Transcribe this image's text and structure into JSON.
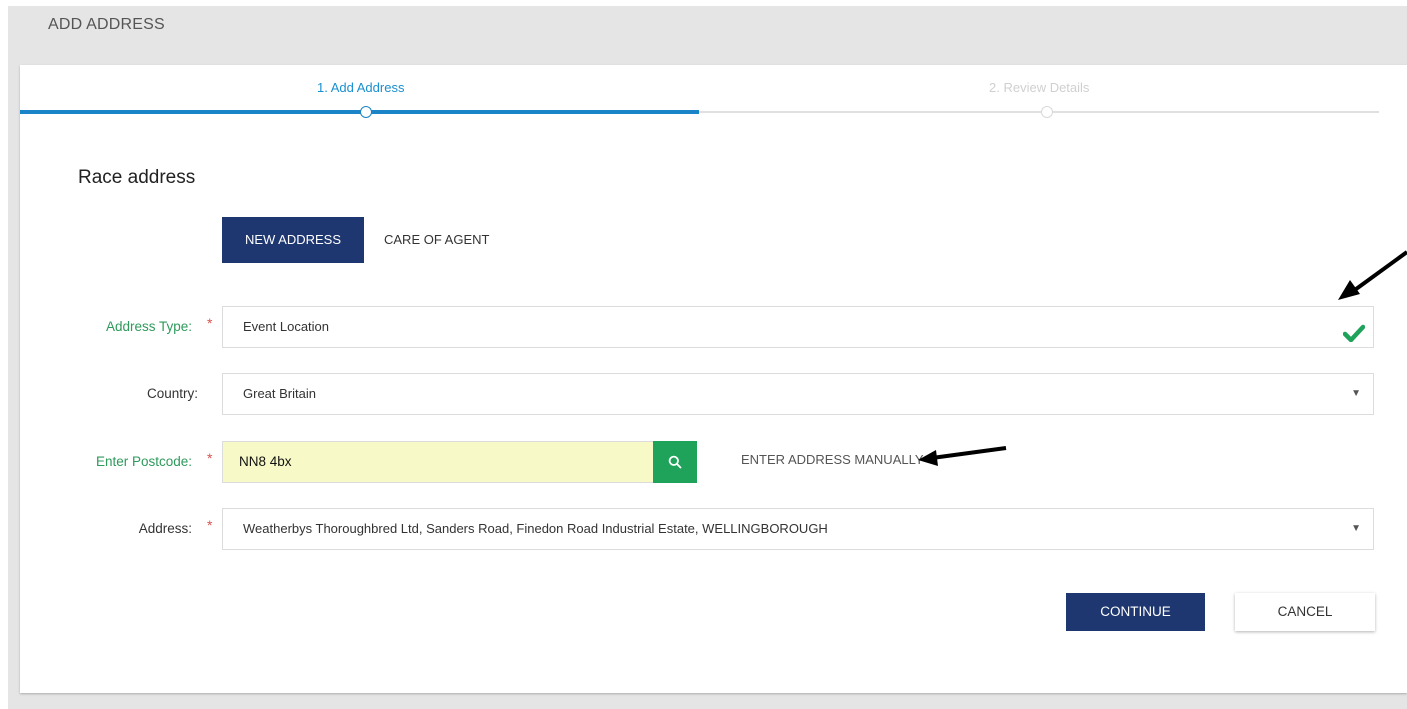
{
  "page": {
    "title": "ADD ADDRESS"
  },
  "stepper": {
    "steps": [
      {
        "label": "1. Add Address",
        "state": "active"
      },
      {
        "label": "2. Review Details",
        "state": "inactive"
      }
    ],
    "accent": "#1b84c7"
  },
  "section": {
    "title": "Race address"
  },
  "tabs": {
    "new_address": "NEW ADDRESS",
    "care_of_agent": "CARE OF AGENT"
  },
  "form": {
    "address_type": {
      "label": "Address Type:",
      "value": "Event Location",
      "required": true,
      "icon": "checkmark-icon"
    },
    "country": {
      "label": "Country:",
      "value": "Great Britain",
      "required": false
    },
    "postcode": {
      "label": "Enter Postcode:",
      "value": "NN8 4bx",
      "required": true
    },
    "enter_manually": "ENTER ADDRESS MANUALLY",
    "address": {
      "label": "Address:",
      "value": "Weatherbys Thoroughbred Ltd, Sanders Road, Finedon Road Industrial Estate, WELLINGBOROUGH",
      "required": true
    },
    "required_marker": "*"
  },
  "actions": {
    "continue": "CONTINUE",
    "cancel": "CANCEL"
  },
  "colors": {
    "primary_navy": "#1f3770",
    "required_green": "#2e9a5b",
    "search_green": "#1fa35a",
    "postcode_bg": "#f7fac6",
    "star_red": "#d9534f"
  }
}
